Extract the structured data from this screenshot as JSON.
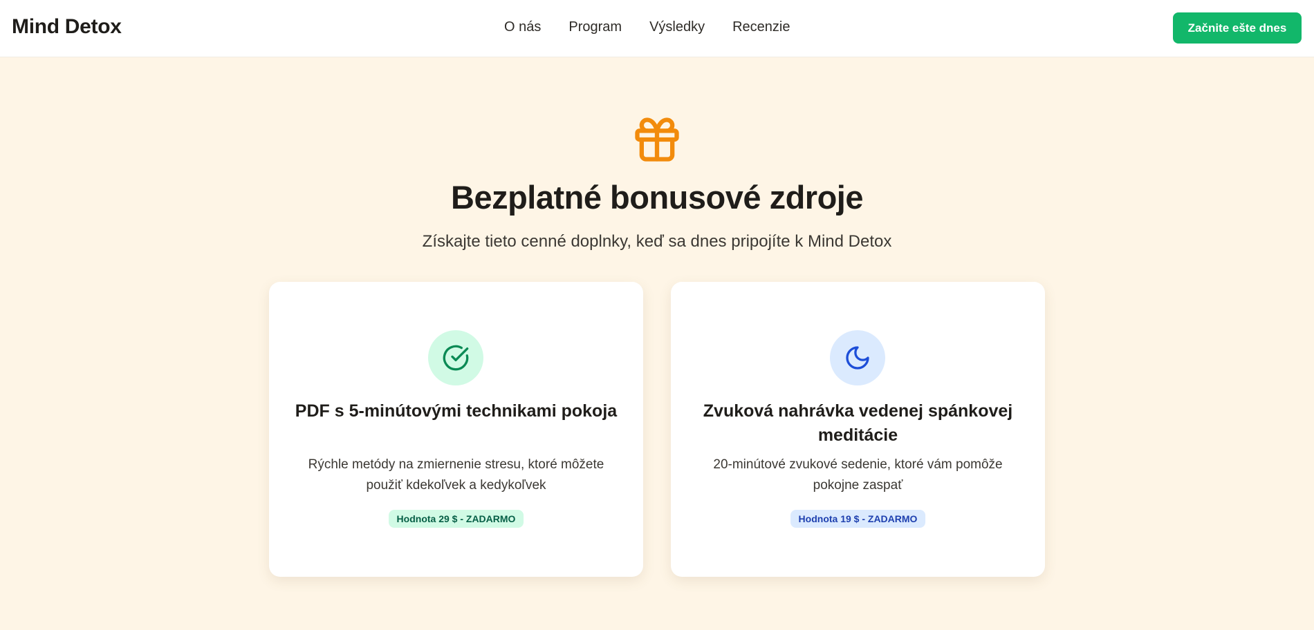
{
  "header": {
    "logo": "Mind Detox",
    "nav": [
      "O nás",
      "Program",
      "Výsledky",
      "Recenzie"
    ],
    "cta_label": "Začnite ešte dnes"
  },
  "hero": {
    "icon": "gift-icon",
    "title": "Bezplatné bonusové zdroje",
    "subtitle": "Získajte tieto cenné doplnky, keď sa dnes pripojíte k Mind Detox"
  },
  "cards": [
    {
      "icon": "check-circle-icon",
      "title": "PDF s 5-minútovými technikami pokoja",
      "description": "Rýchle metódy na zmiernenie stresu, ktoré môžete použiť kdekoľvek a kedykoľvek",
      "badge": "Hodnota 29 $ - ZADARMO"
    },
    {
      "icon": "moon-icon",
      "title": "Zvuková nahrávka vedenej spánkovej meditácie",
      "description": "20-minútové zvukové sedenie, ktoré vám pomôže pokojne zaspať",
      "badge": "Hodnota 19 $ - ZADARMO"
    }
  ],
  "colors": {
    "accent_green": "#12b76a",
    "gift_orange": "#f28b0c",
    "page_background": "#fef5e6",
    "check_green": "#0b8a55",
    "moon_blue": "#1d4ed8"
  }
}
